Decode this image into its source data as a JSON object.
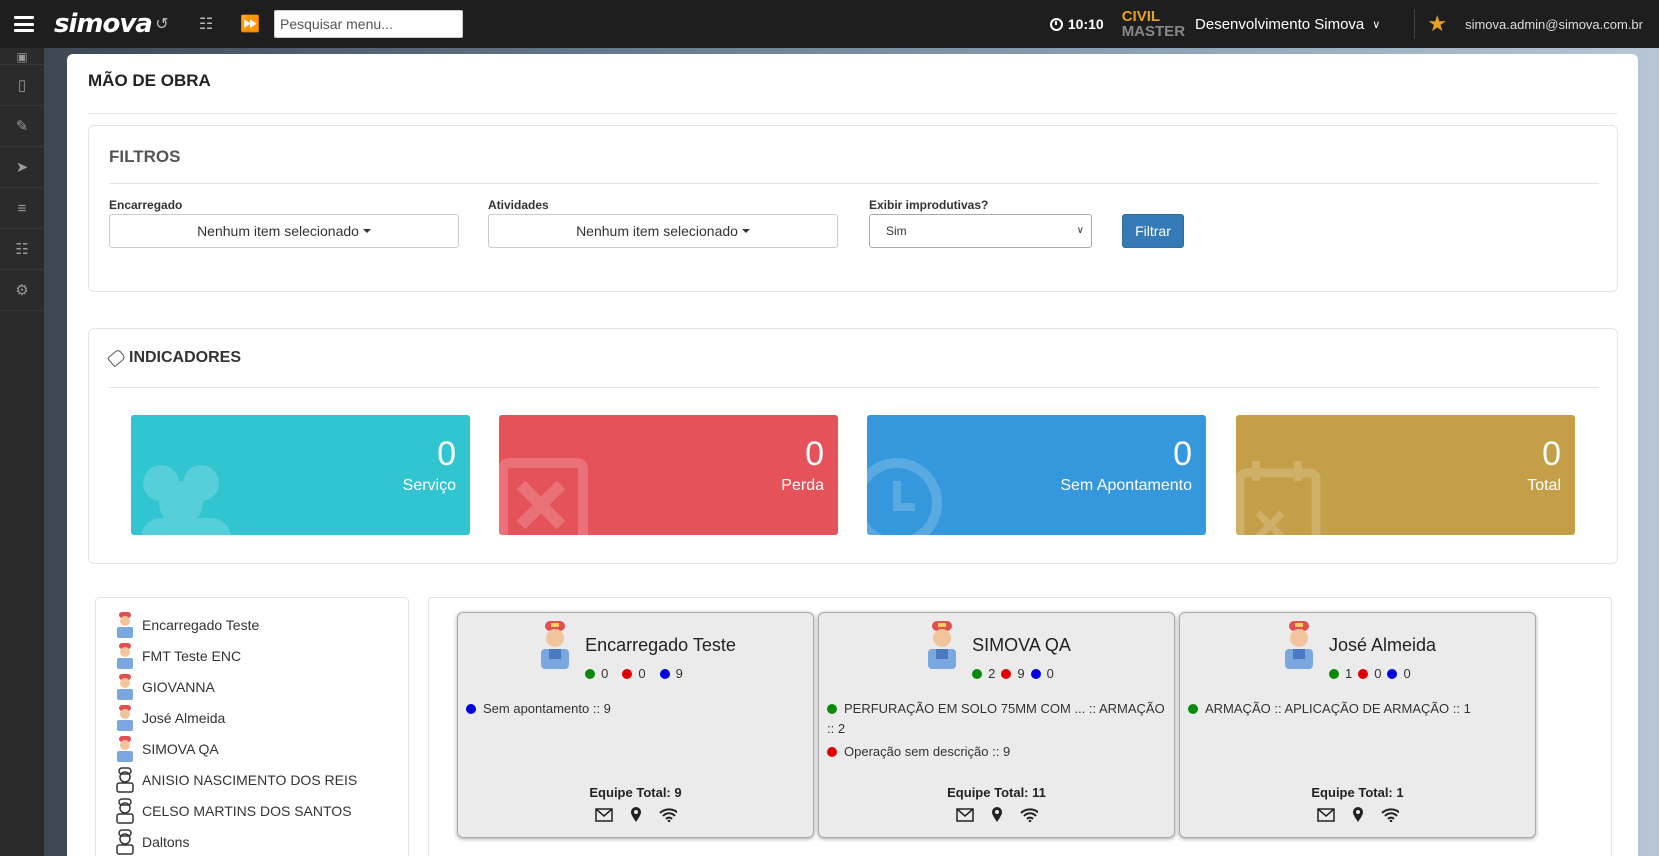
{
  "topbar": {
    "logo_text": "simova",
    "search_placeholder": "Pesquisar menu...",
    "time": "10:10",
    "brand_line1": "CIVIL",
    "brand_line2": "MASTER",
    "company": "Desenvolvimento Simova",
    "user_email": "simova.admin@simova.com.br"
  },
  "sidebar": {
    "icons": [
      "gamepad-icon",
      "tablet-icon",
      "edit-icon",
      "rocket-icon",
      "database-icon",
      "document-icon",
      "settings-icon"
    ]
  },
  "page": {
    "title": "MÃO DE OBRA"
  },
  "filters": {
    "title": "FILTROS",
    "encarregado_label": "Encarregado",
    "encarregado_value": "Nenhum item selecionado",
    "atividades_label": "Atividades",
    "atividades_value": "Nenhum item selecionado",
    "improdutivas_label": "Exibir improdutivas?",
    "improdutivas_value": "Sim",
    "filter_button": "Filtrar"
  },
  "indicators": {
    "title": "INDICADORES",
    "cards": [
      {
        "value": "0",
        "label": "Serviço",
        "color": "#31c5d2"
      },
      {
        "value": "0",
        "label": "Perda",
        "color": "#e5525a"
      },
      {
        "value": "0",
        "label": "Sem Apontamento",
        "color": "#3598dc"
      },
      {
        "value": "0",
        "label": "Total",
        "color": "#c49f47"
      }
    ]
  },
  "encarregados": [
    {
      "name": "Encarregado Teste",
      "type": "encarregado"
    },
    {
      "name": "FMT Teste ENC",
      "type": "encarregado"
    },
    {
      "name": "GIOVANNA",
      "type": "encarregado"
    },
    {
      "name": "José Almeida",
      "type": "encarregado"
    },
    {
      "name": "SIMOVA QA",
      "type": "encarregado"
    },
    {
      "name": "ANISIO NASCIMENTO DOS REIS",
      "type": "worker"
    },
    {
      "name": "CELSO MARTINS DOS SANTOS",
      "type": "worker"
    },
    {
      "name": "Daltons",
      "type": "worker"
    }
  ],
  "team_cards": [
    {
      "name": "Encarregado Teste",
      "green": "0",
      "red": "0",
      "blue": "9",
      "activities": [
        {
          "color": "blue",
          "text": "Sem apontamento :: 9"
        }
      ],
      "total": "Equipe Total: 9"
    },
    {
      "name": "SIMOVA QA",
      "green": "2",
      "red": "9",
      "blue": "0",
      "activities": [
        {
          "color": "green",
          "text": "PERFURAÇÃO EM SOLO 75MM COM ... :: ARMAÇÃO :: 2"
        },
        {
          "color": "red",
          "text": "Operação sem descrição :: 9"
        }
      ],
      "total": "Equipe Total: 11"
    },
    {
      "name": "José Almeida",
      "green": "1",
      "red": "0",
      "blue": "0",
      "activities": [
        {
          "color": "green",
          "text": "ARMAÇÃO :: APLICAÇÃO DE ARMAÇÃO :: 1"
        }
      ],
      "total": "Equipe Total: 1"
    }
  ]
}
